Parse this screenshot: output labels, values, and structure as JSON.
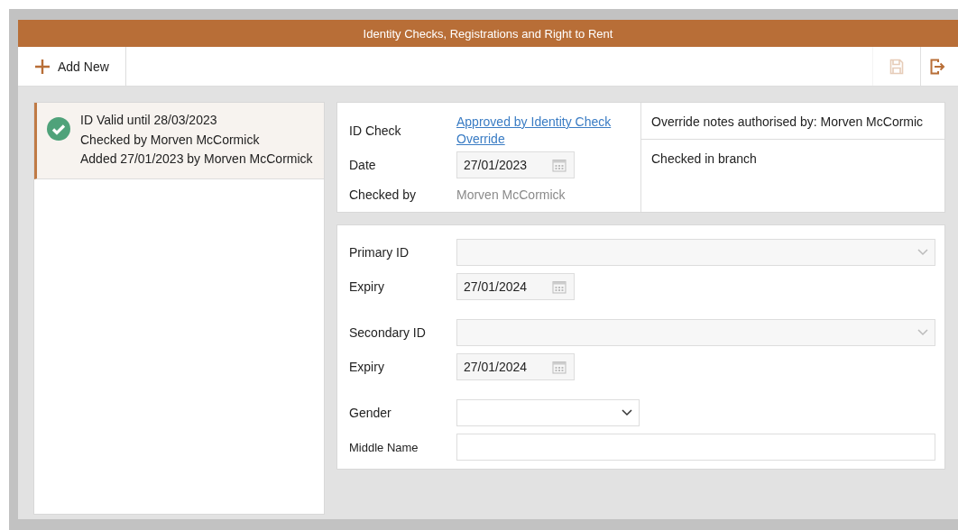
{
  "window": {
    "title": "Identity Checks, Registrations and Right to Rent"
  },
  "toolbar": {
    "add_button": "Add New",
    "save_disabled": true
  },
  "records": [
    {
      "lines": [
        "ID Valid until 28/03/2023",
        "Checked by Morven McCormick",
        "Added 27/01/2023 by Morven McCormick"
      ],
      "selected": true,
      "valid": true
    }
  ],
  "check": {
    "fields": [
      {
        "label": "ID Check",
        "kind": "link",
        "value": "Approved by Identity Check Override"
      },
      {
        "label": "Date",
        "kind": "date",
        "value": "27/01/2023"
      },
      {
        "label": "Checked by",
        "kind": "text",
        "value": "Morven McCormick"
      }
    ],
    "notes": [
      "Override notes authorised by: Morven McCormic",
      "Checked in branch"
    ]
  },
  "form": {
    "groups": [
      [
        {
          "label": "Primary ID",
          "kind": "select",
          "disabled": true
        },
        {
          "label": "Expiry",
          "kind": "date",
          "value": "27/01/2024"
        }
      ],
      [
        {
          "label": "Secondary ID",
          "kind": "select",
          "disabled": true
        },
        {
          "label": "Expiry",
          "kind": "date",
          "value": "27/01/2024"
        }
      ],
      [
        {
          "label": "Gender",
          "kind": "select",
          "disabled": false,
          "short": true
        },
        {
          "label": "Middle Name",
          "kind": "input"
        }
      ]
    ]
  }
}
